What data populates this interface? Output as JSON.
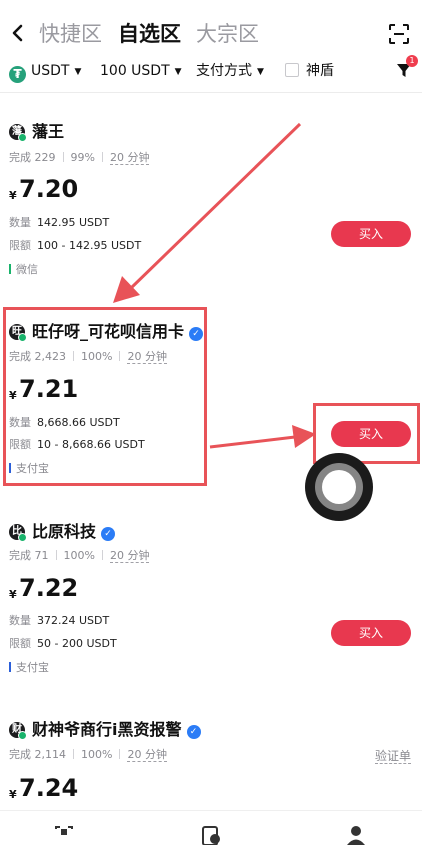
{
  "header": {
    "back_icon": "chevron-left-icon",
    "tabs": [
      "快捷区",
      "自选区",
      "大宗区"
    ],
    "active_tab": "自选区",
    "scan_icon": "scan-icon"
  },
  "filters": {
    "currency": "USDT",
    "amount": "100 USDT",
    "payment": "支付方式",
    "shield_label": "神盾",
    "filter_badge": "1"
  },
  "merchants": [
    {
      "avatar_char": "藩",
      "name": "藩王",
      "verified": false,
      "completed": "完成 229",
      "rate": "99%",
      "time": "20 分钟",
      "currency_symbol": "¥",
      "price": "7.20",
      "qty_label": "数量",
      "qty": "142.95 USDT",
      "limit_label": "限额",
      "limit": "100 - 142.95 USDT",
      "payment": "微信",
      "payment_color": "#19b36b",
      "buy_label": "买入"
    },
    {
      "avatar_char": "旺",
      "name": "旺仔呀_可花呗信用卡",
      "verified": true,
      "completed": "完成 2,423",
      "rate": "100%",
      "time": "20 分钟",
      "currency_symbol": "¥",
      "price": "7.21",
      "qty_label": "数量",
      "qty": "8,668.66 USDT",
      "limit_label": "限额",
      "limit": "10 - 8,668.66 USDT",
      "payment": "支付宝",
      "payment_color": "#2b5fd9",
      "buy_label": "买入"
    },
    {
      "avatar_char": "比",
      "name": "比原科技",
      "verified": true,
      "completed": "完成 71",
      "rate": "100%",
      "time": "20 分钟",
      "currency_symbol": "¥",
      "price": "7.22",
      "qty_label": "数量",
      "qty": "372.24 USDT",
      "limit_label": "限额",
      "limit": "50 - 200 USDT",
      "payment": "支付宝",
      "payment_color": "#2b5fd9",
      "buy_label": "买入"
    },
    {
      "avatar_char": "财",
      "name": "财神爷商行i黑资报警",
      "verified": true,
      "completed": "完成 2,114",
      "rate": "100%",
      "time": "20 分钟",
      "verify_label": "验证单",
      "currency_symbol": "¥",
      "price": "7.24"
    }
  ],
  "annotation_color": "#e85358",
  "accent_color": "#e8384f"
}
